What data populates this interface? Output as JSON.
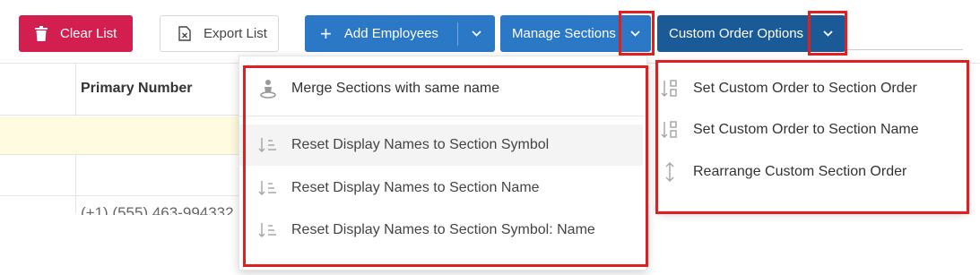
{
  "toolbar": {
    "clear_label": "Clear List",
    "export_label": "Export List",
    "add_label": "Add Employees",
    "manage_label": "Manage Sections",
    "custom_label": "Custom Order Options"
  },
  "table": {
    "column_header": "Primary Number",
    "phone_value": "(+1) (555) 463-994332"
  },
  "manage_menu": {
    "items": [
      {
        "label": "Merge Sections with same name",
        "icon": "merge-people-icon"
      },
      {
        "label": "Reset Display Names to Section Symbol",
        "icon": "sort-lines-icon"
      },
      {
        "label": "Reset Display Names to Section Name",
        "icon": "sort-lines-icon"
      },
      {
        "label": "Reset Display Names to Section Symbol: Name",
        "icon": "sort-lines-icon"
      }
    ]
  },
  "custom_menu": {
    "items": [
      {
        "label": "Set Custom Order to Section Order",
        "icon": "sort-order-icon"
      },
      {
        "label": "Set Custom Order to Section Name",
        "icon": "sort-order-icon"
      },
      {
        "label": "Rearrange Custom Section Order",
        "icon": "vertical-arrows-icon"
      }
    ]
  },
  "colors": {
    "danger": "#d21f50",
    "primary": "#2a78c6",
    "primary_dark": "#1a5a96",
    "highlight": "#e02020"
  }
}
